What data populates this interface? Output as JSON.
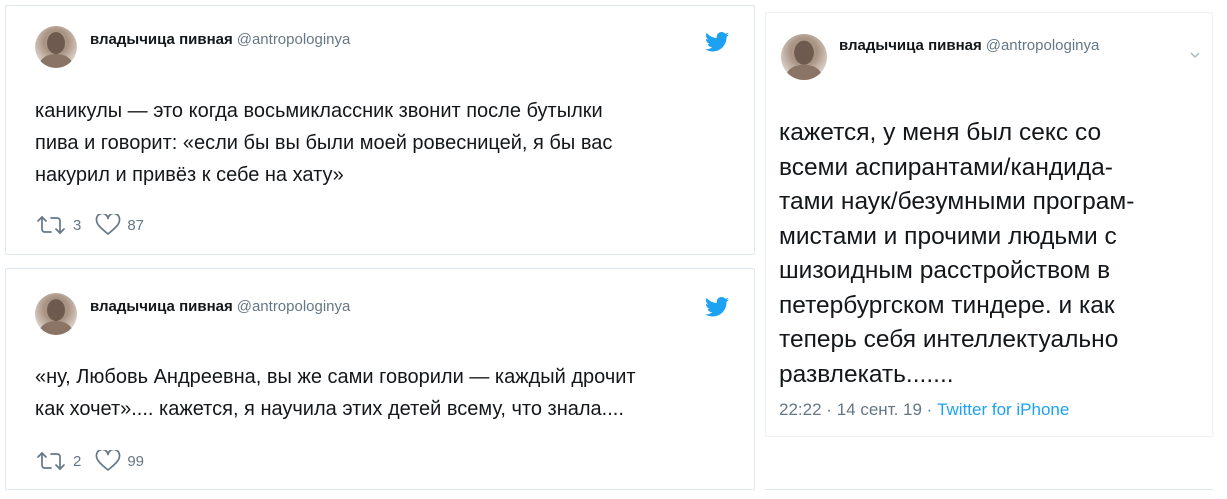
{
  "tweets": [
    {
      "author_name": "владычица пивная",
      "author_handle": "@antropologinya",
      "text": "каникулы — это когда восьмиклассник звонит после бутылки\nпива и говорит: «если бы вы были моей ровесницей, я бы вас\nнакурил и привёз к себе на хату»",
      "retweets": "3",
      "likes": "87"
    },
    {
      "author_name": "владычица пивная",
      "author_handle": "@antropologinya",
      "text": "«ну, Любовь Андреевна, вы же сами говорили — каждый дрочит\nкак хочет».... кажется, я научила этих детей всему, что знала....",
      "retweets": "2",
      "likes": "99"
    },
    {
      "author_name": "владычица пивная",
      "author_handle": "@antropologinya",
      "text": "кажется, у меня был секс со\nвсеми аспирантами/кандида-\nтами наук/безумными програм-\nмистами и прочими людьми с\nшизоидным расстройством в\nпетербургском тиндере. и как\nтеперь себя интеллектуально\nразвлекать.......",
      "time": "22:22",
      "sep1": "·",
      "date": "14 сент. 19",
      "sep2": "·",
      "source": "Twitter for iPhone"
    }
  ],
  "icons": {
    "avatar": "avatar-photo",
    "bird": "twitter-bird-icon",
    "retweet": "retweet-icon",
    "like": "heart-icon",
    "more": "chevron-down-icon"
  },
  "colors": {
    "brand": "#1da1f2",
    "text": "#14171a",
    "muted": "#657786",
    "border": "#e1e8ed"
  }
}
